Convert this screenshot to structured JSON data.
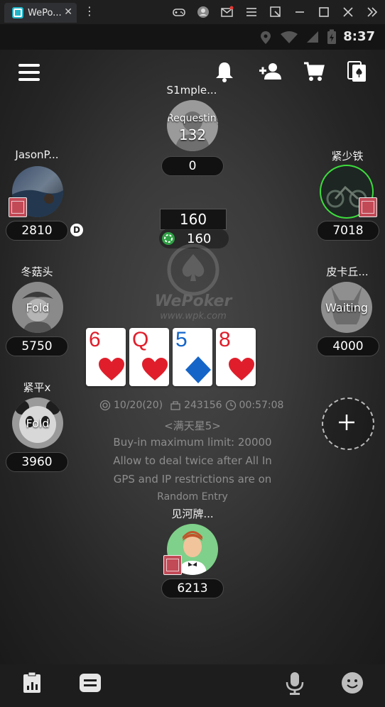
{
  "window": {
    "tab_title": "WePo...",
    "tab_close": "✕",
    "kebab": "⋮"
  },
  "statusbar": {
    "time": "8:37"
  },
  "pot": {
    "main": "160",
    "sub": "160"
  },
  "watermark": {
    "brand": "WePoker",
    "url": "www.wpk.com"
  },
  "players": {
    "top": {
      "name": "S1mple...",
      "status": "Requesting",
      "timer": "132",
      "chips": "0"
    },
    "left1": {
      "name": "JasonP...",
      "chips": "2810",
      "dealer": "D"
    },
    "right1": {
      "name": "紧少铁",
      "chips": "7018"
    },
    "left2": {
      "name": "冬菇头",
      "status": "Fold",
      "chips": "5750"
    },
    "right2": {
      "name": "皮卡丘...",
      "status": "Waiting",
      "chips": "4000"
    },
    "left3": {
      "name": "紧平x",
      "status": "Fold",
      "chips": "3960"
    },
    "bottom": {
      "name": "见河牌...",
      "chips": "6213"
    }
  },
  "board": [
    {
      "rank": "6",
      "suit": "heart",
      "color": "#e01e2b"
    },
    {
      "rank": "Q",
      "suit": "heart",
      "color": "#e01e2b"
    },
    {
      "rank": "5",
      "suit": "diamond",
      "color": "#1565c9"
    },
    {
      "rank": "8",
      "suit": "heart",
      "color": "#e01e2b"
    }
  ],
  "table_info": {
    "blinds": "10/20(20)",
    "table_id": "243156",
    "clock": "00:57:08",
    "name": "<满天星5>",
    "buyin": "Buy-in maximum limit: 20000",
    "deal_twice": "Allow to deal twice after All In",
    "gps": "GPS and IP restrictions are on",
    "entry": "Random Entry"
  },
  "colors": {
    "heart": "#e01e2b",
    "diamond": "#1565c9",
    "active_ring": "#3ddc3d"
  }
}
